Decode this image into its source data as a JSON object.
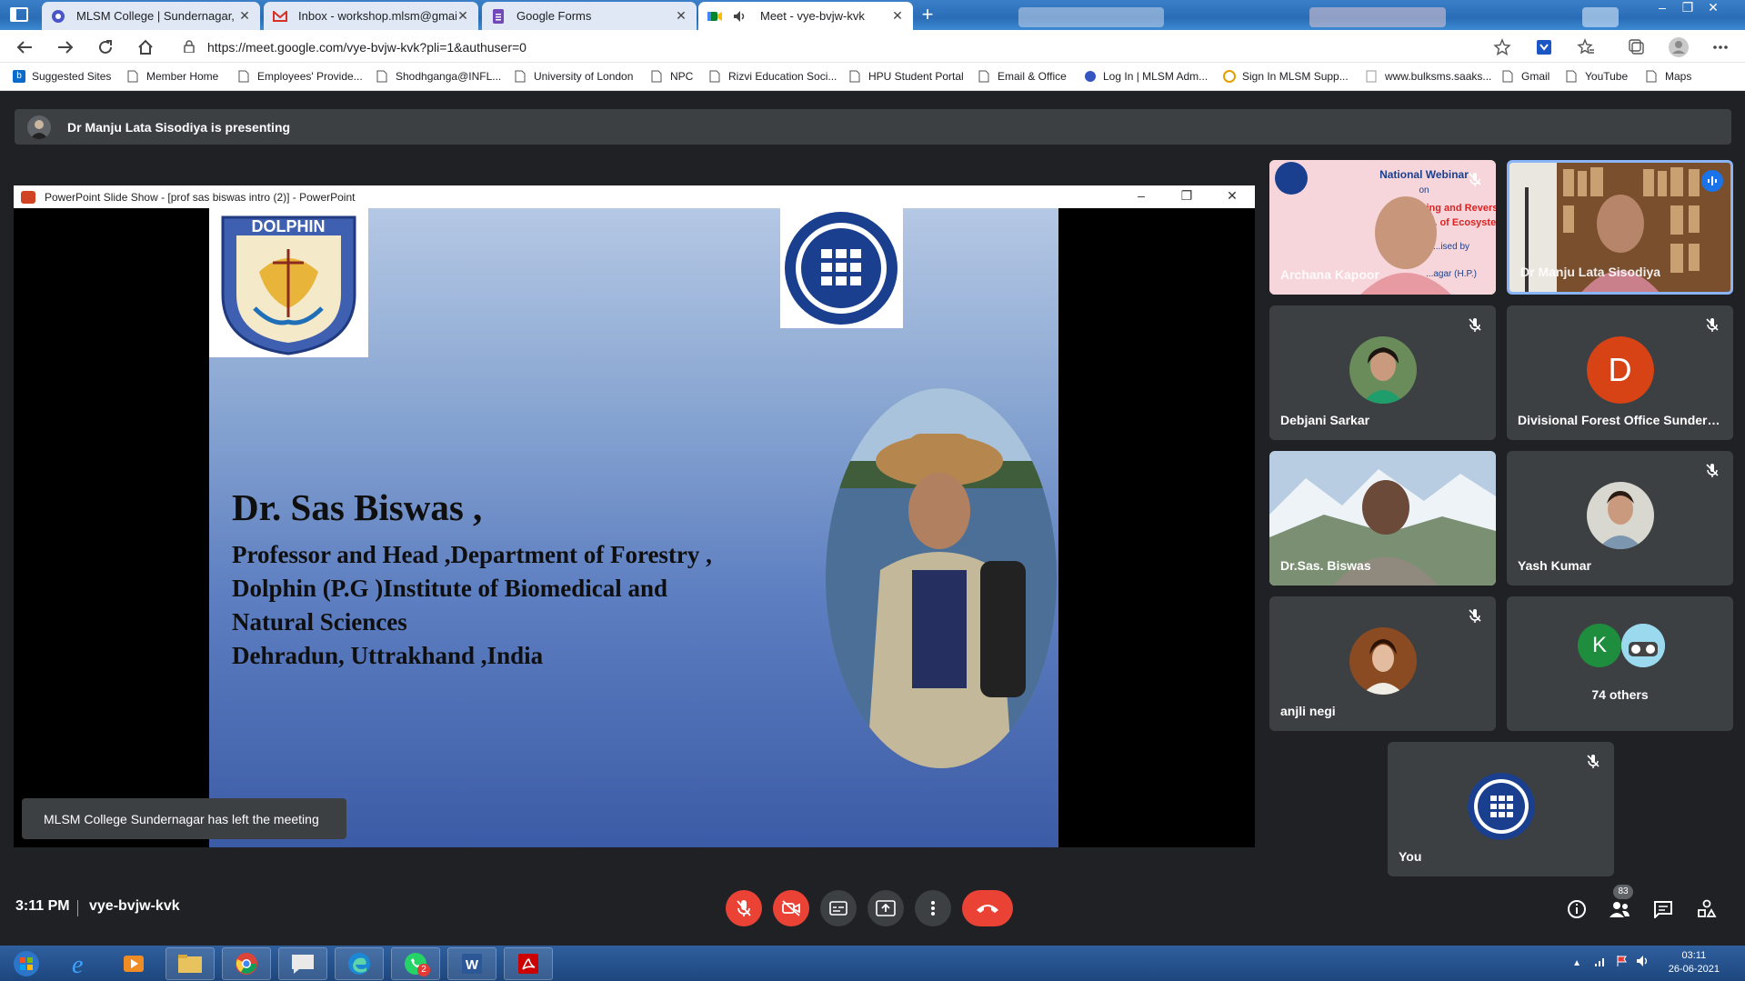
{
  "browser": {
    "tabs": [
      {
        "title": "MLSM College | Sundernagar, M",
        "icon": "college-favicon"
      },
      {
        "title": "Inbox - workshop.mlsm@gmail.c",
        "icon": "gmail-icon"
      },
      {
        "title": "Google Forms",
        "icon": "google-forms-icon"
      },
      {
        "title": "Meet - vye-bvjw-kvk",
        "icon": "google-meet-icon"
      }
    ],
    "url": "https://meet.google.com/vye-bvjw-kvk?pli=1&authuser=0",
    "bookmarks": [
      "Suggested Sites",
      "Member Home",
      "Employees' Provide...",
      "Shodhganga@INFL...",
      "University of London",
      "NPC",
      "Rizvi Education Soci...",
      "HPU Student Portal",
      "Email & Office",
      "Log In | MLSM Adm...",
      "Sign In MLSM Supp...",
      "www.bulksms.saaks...",
      "Gmail",
      "YouTube",
      "Maps"
    ]
  },
  "meet": {
    "presenting_banner": "Dr Manju Lata Sisodiya is presenting",
    "ppt_title": "PowerPoint Slide Show - [prof sas biswas intro (2)] - PowerPoint",
    "slide": {
      "name": "Dr. Sas Biswas ,",
      "lines": [
        "Professor and Head ,Department of Forestry ,",
        "Dolphin  (P.G )Institute of Biomedical and",
        "Natural Sciences",
        "Dehradun, Uttrakhand ,India"
      ],
      "left_logo_text": "DOLPHIN",
      "webinar_thumb": [
        "National Webinar",
        "on",
        "Preventing and Reversing",
        "the Deg... of Ecosystems",
        "...ised by",
        "...agar (H.P.)"
      ]
    },
    "toast": "MLSM College Sundernagar has left the meeting",
    "participants": [
      {
        "name": "Archana Kapoor",
        "muted": true
      },
      {
        "name": "Dr Manju Lata Sisodiya",
        "muted": false
      },
      {
        "name": "Debjani Sarkar",
        "muted": true
      },
      {
        "name": "Divisional Forest Office Sundern...",
        "muted": true,
        "letter": "D"
      },
      {
        "name": "Dr.Sas. Biswas",
        "muted": false
      },
      {
        "name": "Yash Kumar",
        "muted": true
      },
      {
        "name": "anjli negi",
        "muted": true
      },
      {
        "name": "74 others",
        "letter": "K"
      },
      {
        "name": "You",
        "muted": true
      }
    ],
    "time": "3:11 PM",
    "meeting_code": "vye-bvjw-kvk",
    "people_count": "83"
  },
  "colors": {
    "meet_bg": "#202124",
    "tile_bg": "#3c4043",
    "danger": "#ea4335",
    "active_speaker": "#8ab4f8"
  },
  "taskbar": {
    "clock_time": "03:11",
    "clock_date": "26-06-2021",
    "whatsapp_badge": "2"
  }
}
